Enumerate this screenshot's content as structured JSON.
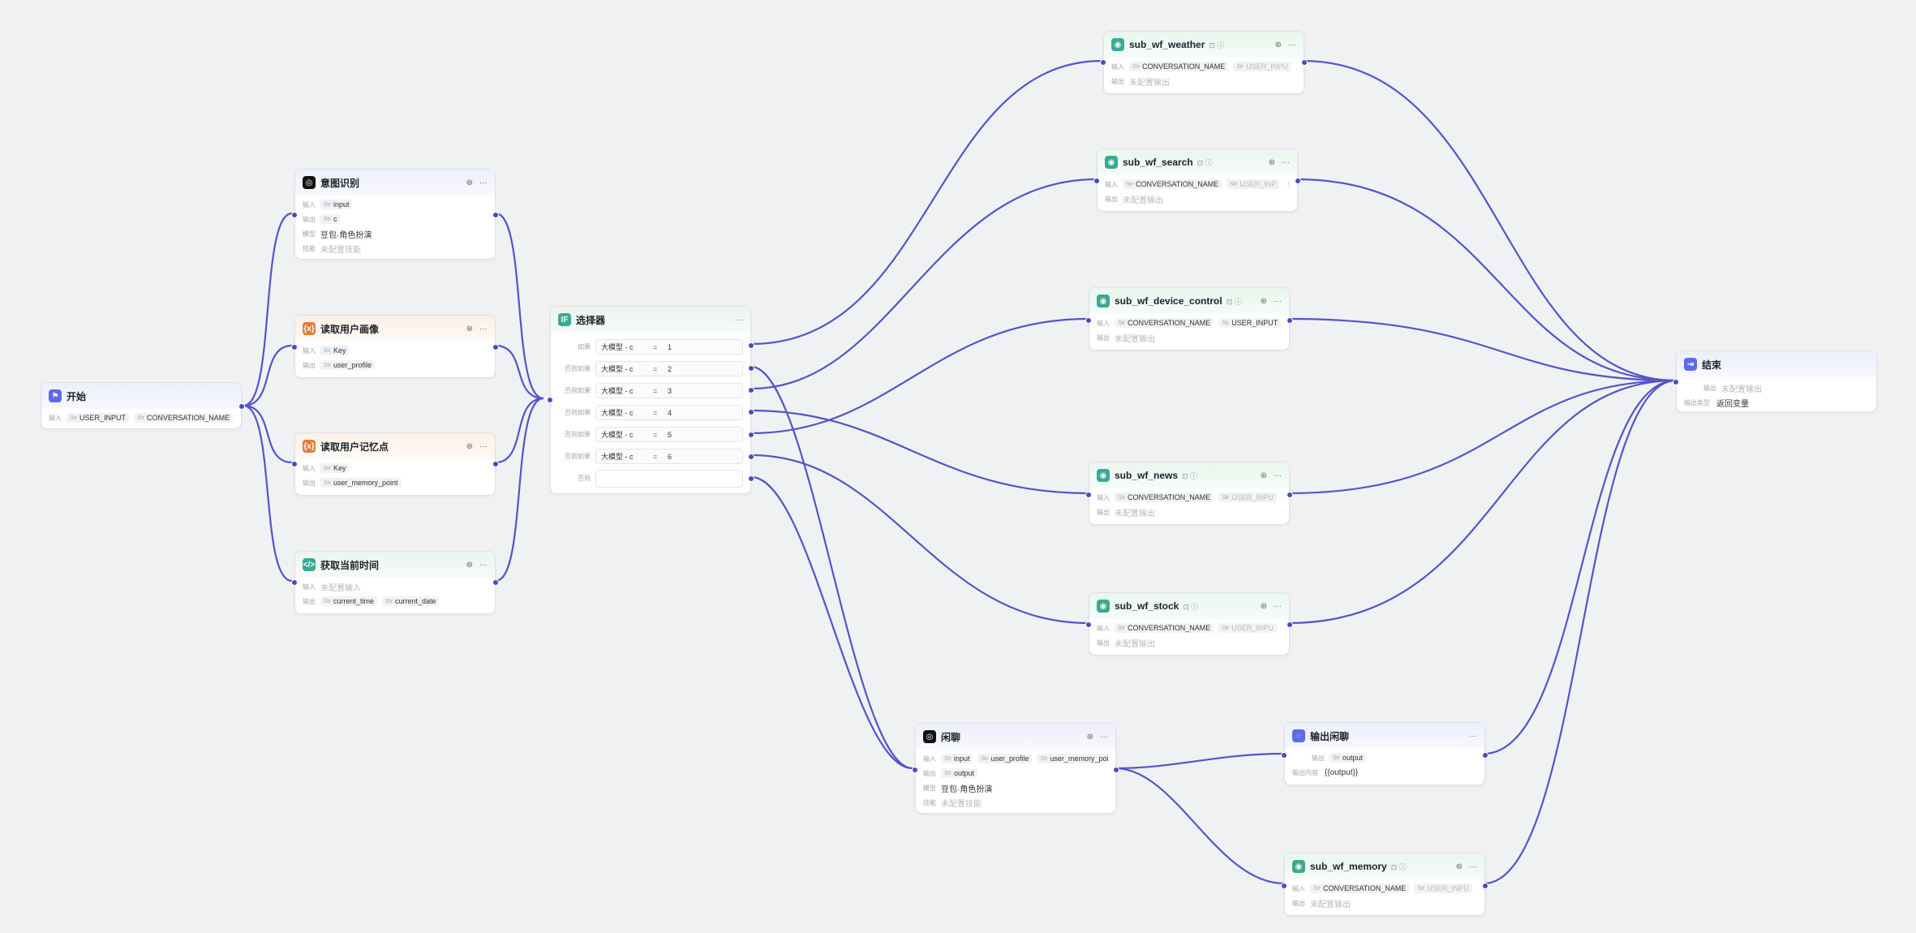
{
  "nodes": {
    "start": {
      "title": "开始",
      "in_label": "输入",
      "inputs": [
        "USER_INPUT",
        "CONVERSATION_NAME"
      ]
    },
    "intent": {
      "title": "意图识别",
      "in_label": "输入",
      "input": "input",
      "out_label": "输出",
      "output": "c",
      "model_label": "模型",
      "model": "豆包·角色扮演",
      "skill_label": "技能",
      "skill": "未配置技能"
    },
    "profile": {
      "title": "读取用户画像",
      "in_label": "输入",
      "input": "Key",
      "out_label": "输出",
      "output": "user_profile"
    },
    "memory_read": {
      "title": "读取用户记忆点",
      "in_label": "输入",
      "input": "Key",
      "out_label": "输出",
      "output": "user_memory_point"
    },
    "time": {
      "title": "获取当前时间",
      "in_label": "输入",
      "input": "未配置输入",
      "out_label": "输出",
      "outputs": [
        "current_time",
        "current_date"
      ]
    },
    "selector": {
      "title": "选择器",
      "rows": [
        {
          "label": "如果",
          "left": "大模型 - c",
          "op": "=",
          "right": "1"
        },
        {
          "label": "否则如果",
          "left": "大模型 - c",
          "op": "=",
          "right": "2"
        },
        {
          "label": "否则如果",
          "left": "大模型 - c",
          "op": "=",
          "right": "3"
        },
        {
          "label": "否则如果",
          "left": "大模型 - c",
          "op": "=",
          "right": "4"
        },
        {
          "label": "否则如果",
          "left": "大模型 - c",
          "op": "=",
          "right": "5"
        },
        {
          "label": "否则如果",
          "left": "大模型 - c",
          "op": "=",
          "right": "6"
        }
      ],
      "else_label": "否则"
    },
    "weather": {
      "title": "sub_wf_weather",
      "in_label": "输入",
      "inputs": [
        "CONVERSATION_NAME",
        "USER_INPU"
      ],
      "out_label": "输出",
      "output": "未配置输出"
    },
    "search": {
      "title": "sub_wf_search",
      "in_label": "输入",
      "inputs": [
        "CONVERSATION_NAME",
        "USER_INP"
      ],
      "out_label": "输出",
      "output": "未配置输出"
    },
    "device": {
      "title": "sub_wf_device_control",
      "in_label": "输入",
      "inputs": [
        "CONVERSATION_NAME",
        "USER_INPUT"
      ],
      "out_label": "输出",
      "output": "未配置输出"
    },
    "news": {
      "title": "sub_wf_news",
      "in_label": "输入",
      "inputs": [
        "CONVERSATION_NAME",
        "USER_INPU"
      ],
      "out_label": "输出",
      "output": "未配置输出"
    },
    "stock": {
      "title": "sub_wf_stock",
      "in_label": "输入",
      "inputs": [
        "CONVERSATION_NAME",
        "USER_INPU"
      ],
      "out_label": "输出",
      "output": "未配置输出"
    },
    "chat": {
      "title": "闲聊",
      "in_label": "输入",
      "inputs": [
        "input",
        "user_profile",
        "user_memory_point"
      ],
      "out_label": "输出",
      "output": "output",
      "model_label": "模型",
      "model": "豆包·角色扮演",
      "skill_label": "技能",
      "skill": "未配置技能"
    },
    "chat_out": {
      "title": "输出闲聊",
      "out_label": "输出",
      "output": "output",
      "content_label": "输出内容",
      "content": "{{output}}"
    },
    "memory": {
      "title": "sub_wf_memory",
      "in_label": "输入",
      "inputs": [
        "CONVERSATION_NAME",
        "USER_INPU"
      ],
      "out_label": "输出",
      "output": "未配置输出"
    },
    "end": {
      "title": "结束",
      "out_label": "输出",
      "output": "未配置输出",
      "type_label": "输出类型",
      "type_value": "返回变量"
    }
  },
  "type_prefix": "Str",
  "more_label": "···",
  "icons": {
    "start": "flag-icon",
    "llm": "llm-icon",
    "variable": "variable-icon",
    "code": "code-icon",
    "condition": "condition-icon",
    "workflow": "workflow-icon",
    "message": "message-icon",
    "end": "end-icon"
  }
}
